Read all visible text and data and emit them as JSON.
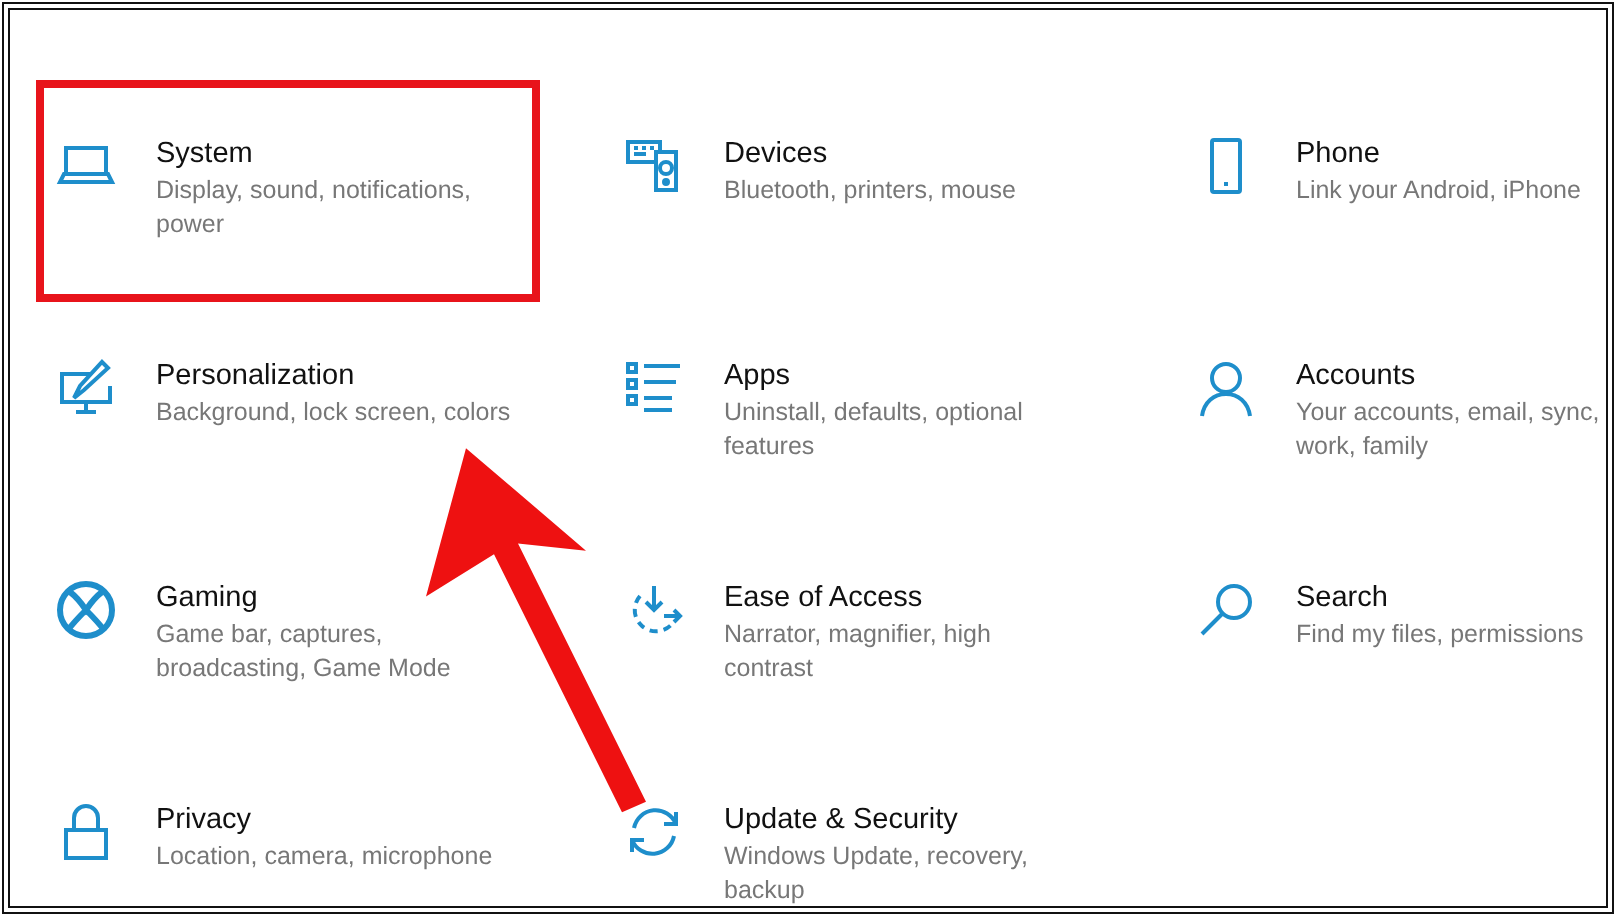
{
  "settings": [
    {
      "title": "System",
      "description": "Display, sound, notifications, power",
      "highlighted": true
    },
    {
      "title": "Devices",
      "description": "Bluetooth, printers, mouse",
      "highlighted": false
    },
    {
      "title": "Phone",
      "description": "Link your Android, iPhone",
      "highlighted": false
    },
    {
      "title": "Personalization",
      "description": "Background, lock screen, colors",
      "highlighted": false
    },
    {
      "title": "Apps",
      "description": "Uninstall, defaults, optional features",
      "highlighted": false
    },
    {
      "title": "Accounts",
      "description": "Your accounts, email, sync, work, family",
      "highlighted": false
    },
    {
      "title": "Gaming",
      "description": "Game bar, captures, broadcasting, Game Mode",
      "highlighted": false
    },
    {
      "title": "Ease of Access",
      "description": "Narrator, magnifier, high contrast",
      "highlighted": false
    },
    {
      "title": "Search",
      "description": "Find my files, permissions",
      "highlighted": false
    },
    {
      "title": "Privacy",
      "description": "Location, camera, microphone",
      "highlighted": false
    },
    {
      "title": "Update & Security",
      "description": "Windows Update, recovery, backup",
      "highlighted": false
    }
  ],
  "annotation": {
    "kind": "arrow"
  }
}
